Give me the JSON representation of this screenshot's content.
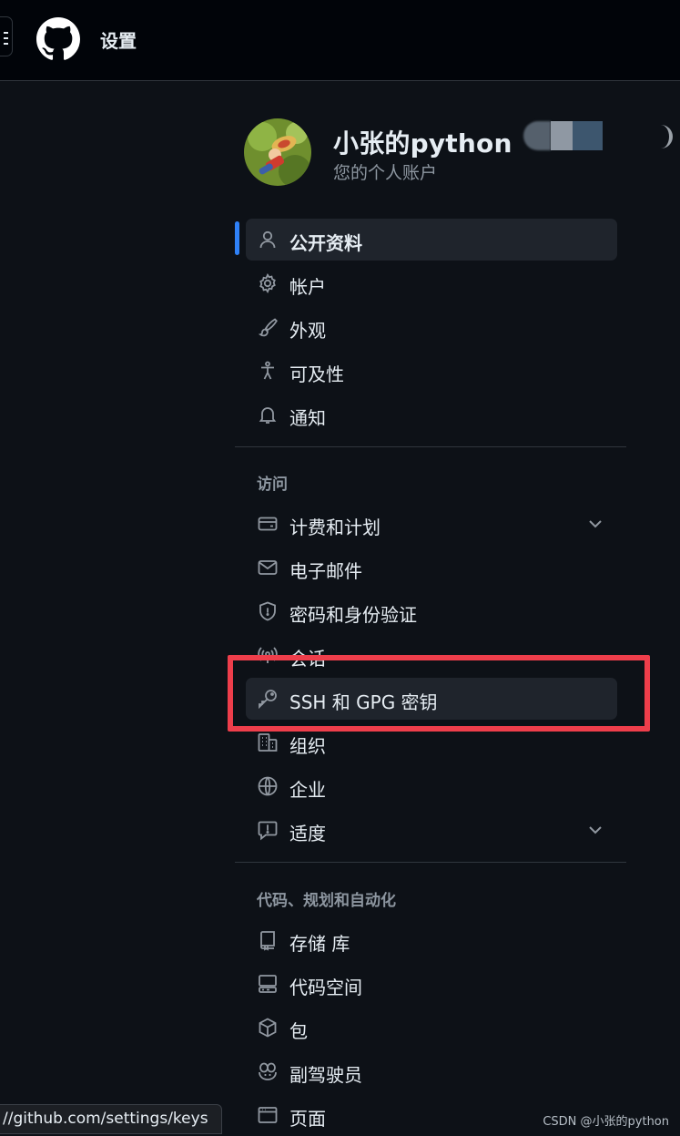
{
  "header": {
    "title": "设置"
  },
  "profile": {
    "name": "小张的python",
    "subtitle": "您的个人账户"
  },
  "nav_primary": [
    {
      "label": "公开资料",
      "icon": "person-icon",
      "active": true
    },
    {
      "label": "帐户",
      "icon": "gear-icon"
    },
    {
      "label": "外观",
      "icon": "paintbrush-icon"
    },
    {
      "label": "可及性",
      "icon": "accessibility-icon"
    },
    {
      "label": "通知",
      "icon": "bell-icon"
    }
  ],
  "sections": {
    "access": "访问",
    "code": "代码、规划和自动化"
  },
  "nav_access": [
    {
      "label": "计费和计划",
      "icon": "credit-card-icon",
      "expandable": true
    },
    {
      "label": "电子邮件",
      "icon": "mail-icon"
    },
    {
      "label": "密码和身份验证",
      "icon": "shield-lock-icon"
    },
    {
      "label": "会话",
      "icon": "broadcast-icon"
    },
    {
      "label": "SSH 和 GPG 密钥",
      "icon": "key-icon",
      "highlighted": true
    },
    {
      "label": "组织",
      "icon": "organization-icon"
    },
    {
      "label": "企业",
      "icon": "globe-icon"
    },
    {
      "label": "适度",
      "icon": "report-icon",
      "expandable": true
    }
  ],
  "nav_code": [
    {
      "label": "存储 库",
      "icon": "repo-icon"
    },
    {
      "label": "代码空间",
      "icon": "codespaces-icon"
    },
    {
      "label": "包",
      "icon": "package-icon"
    },
    {
      "label": "副驾驶员",
      "icon": "copilot-icon"
    },
    {
      "label": "页面",
      "icon": "browser-icon"
    }
  ],
  "status_url": "//github.com/settings/keys",
  "watermark": "CSDN @小张的python",
  "colors": {
    "background": "#0d1117",
    "accent": "#2f81f7",
    "annotation": "#ee3e4b"
  }
}
